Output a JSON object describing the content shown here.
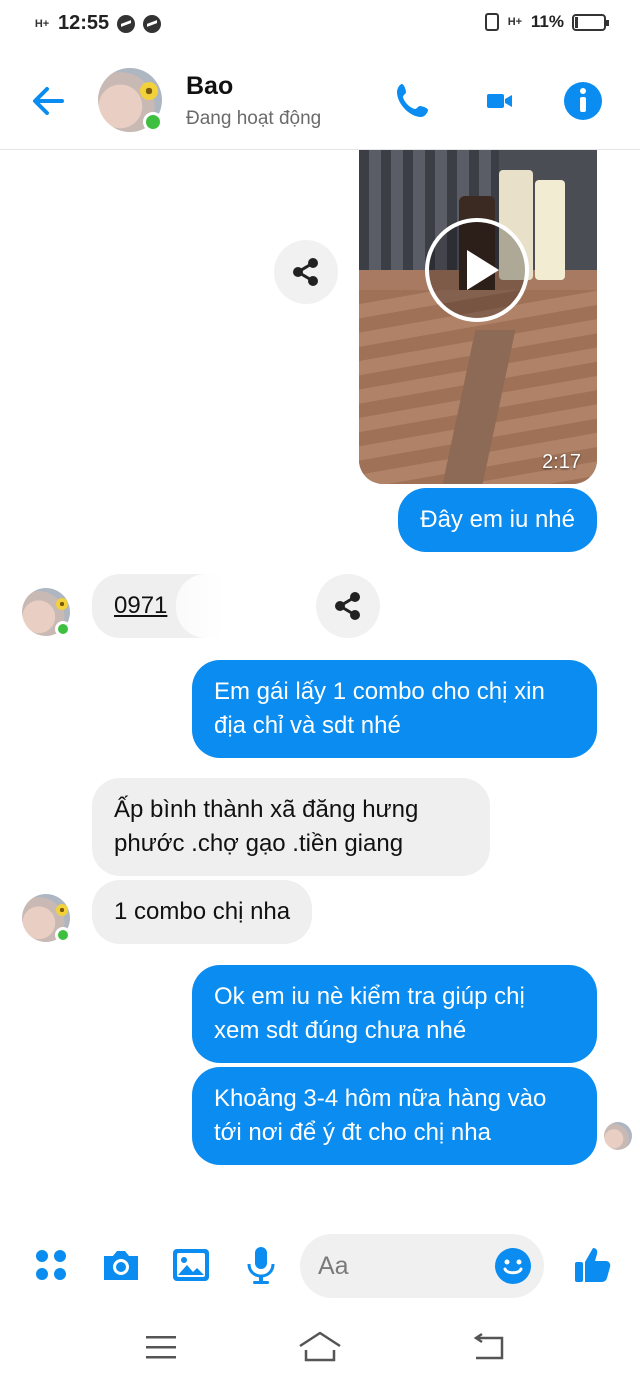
{
  "status_bar": {
    "time": "12:55",
    "battery_percent": "11%",
    "battery_level": 0.11,
    "network_left": "H+",
    "network_right": "H+"
  },
  "header": {
    "contact_name": "Bao",
    "contact_status": "Đang hoạt động",
    "icons": [
      "back-arrow-icon",
      "phone-icon",
      "video-camera-icon",
      "info-icon"
    ],
    "accent_color": "#0a8cf0"
  },
  "messages": {
    "video": {
      "duration": "2:17"
    },
    "m1": "Đây em iu nhé",
    "m2": "0971",
    "m3": "Em gái lấy 1 combo cho chị xin địa chỉ và sdt nhé",
    "m4": "Ấp bình thành xã đăng hưng phước .chợ gạo .tiền giang",
    "m5": "1 combo chị nha",
    "m6": "Ok em iu nè kiểm tra giúp chị xem sdt đúng chưa nhé",
    "m7": "Khoảng 3-4 hôm nữa hàng vào tới nơi để ý đt cho chị nha"
  },
  "composer": {
    "placeholder": "Aa",
    "icons": [
      "apps-icon",
      "camera-icon",
      "gallery-icon",
      "microphone-icon",
      "emoji-icon",
      "thumbs-up-icon"
    ]
  },
  "navbar": {
    "icons": [
      "menu-icon",
      "home-icon",
      "back-icon"
    ]
  }
}
